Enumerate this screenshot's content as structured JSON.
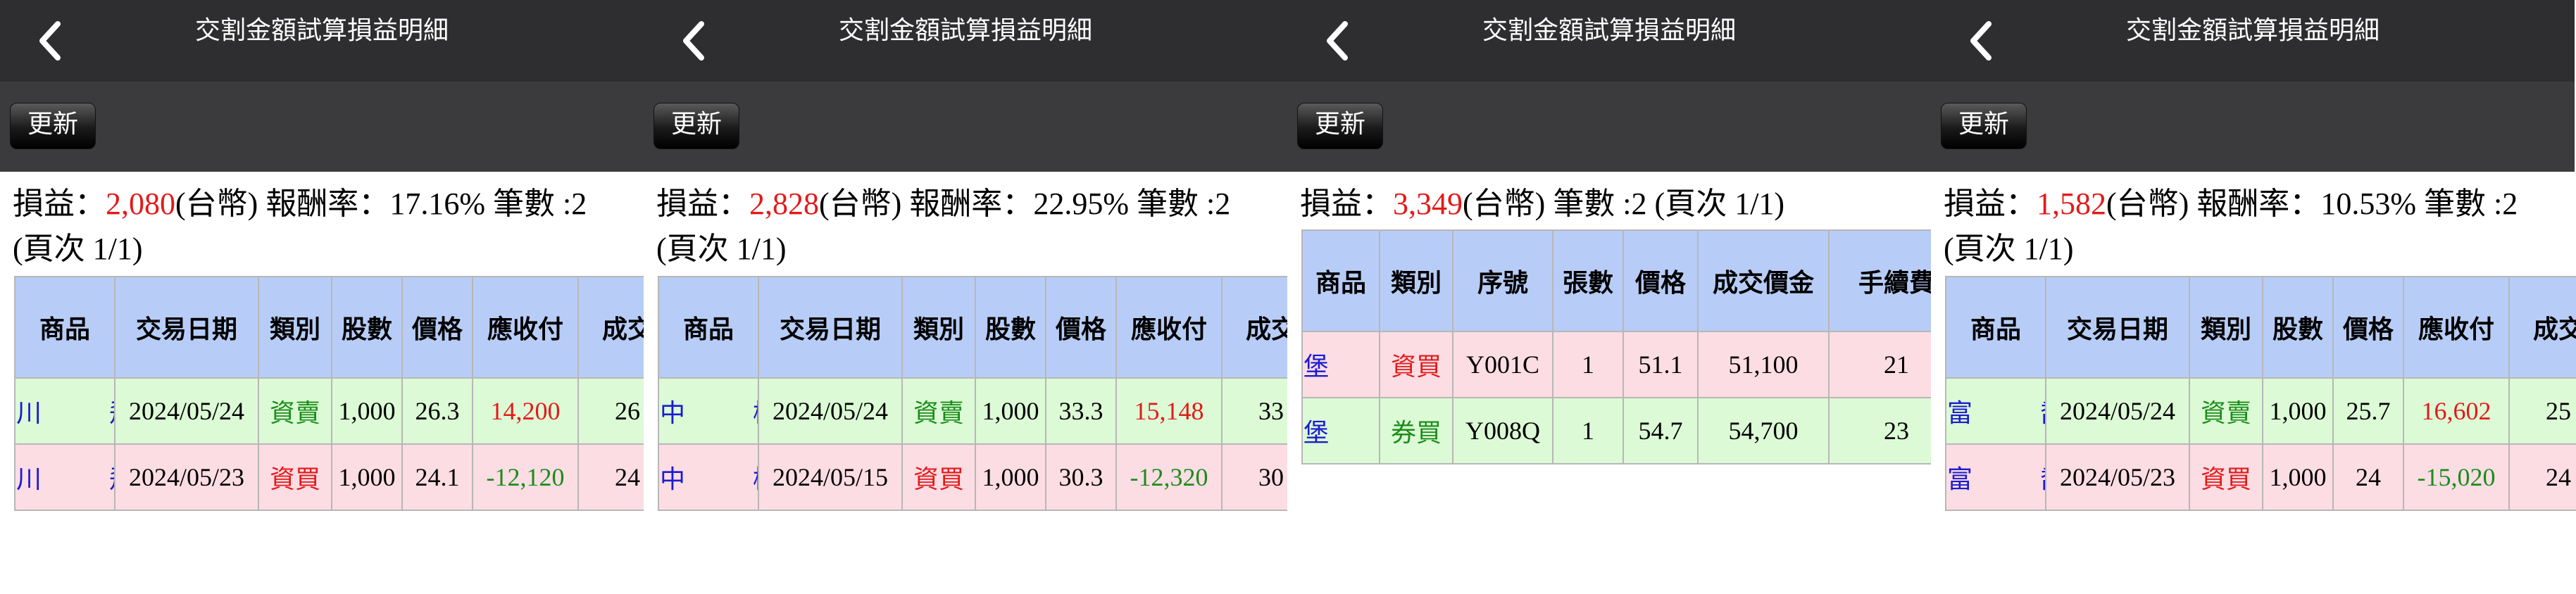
{
  "panels": [
    {
      "title": "交割金額試算損益明細",
      "refresh_label": "更新",
      "summary": {
        "label_pl": "損益：",
        "pl": "2,080",
        "pl_unit": "(台幣) ",
        "ret_label": "報酬率：",
        "ret": "17.16%",
        "count_label": " 筆數 :",
        "count": "2",
        "page": "(頁次 1/1)"
      },
      "headers": [
        "商品",
        "交易日期",
        "類別",
        "股數",
        "價格",
        "應收付",
        "成交"
      ],
      "rows": [
        [
          "川　飛",
          "2024/05/24",
          "資賣",
          "1,000",
          "26.3",
          "14,200",
          "26"
        ],
        [
          "川　飛",
          "2024/05/23",
          "資買",
          "1,000",
          "24.1",
          "-12,120",
          "24"
        ]
      ]
    },
    {
      "title": "交割金額試算損益明細",
      "refresh_label": "更新",
      "summary": {
        "label_pl": "損益：",
        "pl": "2,828",
        "pl_unit": "(台幣) ",
        "ret_label": "報酬率：",
        "ret": "22.95%",
        "count_label": " 筆數 :",
        "count": "2",
        "page": "(頁次 1/1)"
      },
      "headers": [
        "商品",
        "交易日期",
        "類別",
        "股數",
        "價格",
        "應收付",
        "成交"
      ],
      "rows": [
        [
          "中　櫃",
          "2024/05/24",
          "資賣",
          "1,000",
          "33.3",
          "15,148",
          "33"
        ],
        [
          "中　櫃",
          "2024/05/15",
          "資買",
          "1,000",
          "30.3",
          "-12,320",
          "30"
        ]
      ]
    },
    {
      "title": "交割金額試算損益明細",
      "refresh_label": "更新",
      "summary": {
        "label_pl": "損益：",
        "pl": "3,349",
        "pl_unit": "(台幣) ",
        "count_label": "筆數 :",
        "count": "2",
        "page": " (頁次 1/1)"
      },
      "headers": [
        "商品",
        "類別",
        "序號",
        "張數",
        "價格",
        "成交價金",
        "手續費"
      ],
      "rows": [
        [
          "堡　達",
          "資買",
          "Y001C",
          "1",
          "51.1",
          "51,100",
          "21"
        ],
        [
          "堡　達",
          "券買",
          "Y008Q",
          "1",
          "54.7",
          "54,700",
          "23"
        ]
      ]
    },
    {
      "title": "交割金額試算損益明細",
      "refresh_label": "更新",
      "summary": {
        "label_pl": "損益：",
        "pl": "1,582",
        "pl_unit": "(台幣) ",
        "ret_label": "報酬率：",
        "ret": "10.53%",
        "count_label": " 筆數 :",
        "count": "2",
        "page": "(頁次 1/1)"
      },
      "headers": [
        "商品",
        "交易日期",
        "類別",
        "股數",
        "價格",
        "應收付",
        "成交"
      ],
      "rows": [
        [
          "富　喬",
          "2024/05/24",
          "資賣",
          "1,000",
          "25.7",
          "16,602",
          "25"
        ],
        [
          "富　喬",
          "2024/05/23",
          "資買",
          "1,000",
          "24",
          "-15,020",
          "24"
        ]
      ]
    }
  ]
}
